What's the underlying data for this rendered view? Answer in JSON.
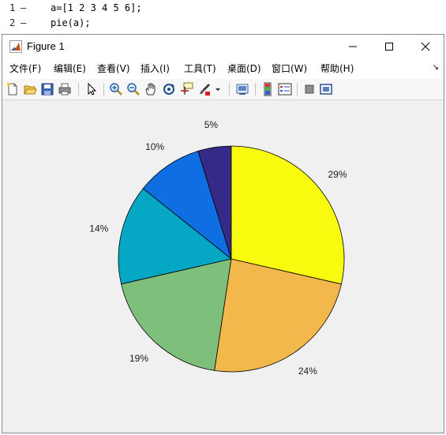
{
  "editor": {
    "lines": [
      {
        "number": "1",
        "marker": "—",
        "code": "a=[1 2 3 4 5 6];"
      },
      {
        "number": "2",
        "marker": "—",
        "code": "pie(a);"
      }
    ]
  },
  "window": {
    "title": "Figure 1",
    "controls": {
      "minimize": "—",
      "maximize": "☐",
      "close": "✕"
    }
  },
  "menu": {
    "items": [
      {
        "label": "文件(F)"
      },
      {
        "label": "编辑(E)"
      },
      {
        "label": "查看(V)"
      },
      {
        "label": "插入(I)"
      },
      {
        "label": "工具(T)"
      },
      {
        "label": "桌面(D)"
      },
      {
        "label": "窗口(W)"
      },
      {
        "label": "帮助(H)"
      }
    ],
    "overflow": "↘"
  },
  "toolbar": {
    "icons": [
      "new-figure-icon",
      "open-file-icon",
      "save-icon",
      "print-icon",
      "select-arrow-icon",
      "zoom-in-icon",
      "zoom-out-icon",
      "pan-hand-icon",
      "rotate-3d-icon",
      "data-cursor-icon",
      "brush-icon",
      "brush-dropdown-icon",
      "link-plot-icon",
      "colorbar-icon",
      "legend-icon",
      "hide-plot-tools-icon",
      "show-plot-tools-icon"
    ]
  },
  "chart_data": {
    "type": "pie",
    "values": [
      1,
      2,
      3,
      4,
      5,
      6
    ],
    "labels": [
      "5%",
      "10%",
      "14%",
      "19%",
      "24%",
      "29%"
    ],
    "colors": [
      "#352a87",
      "#0f6ee1",
      "#05a8c4",
      "#7ebf7b",
      "#f2b84b",
      "#f9fb0e"
    ],
    "start": "top",
    "direction": "counterclockwise",
    "title": "",
    "legend": "none"
  }
}
